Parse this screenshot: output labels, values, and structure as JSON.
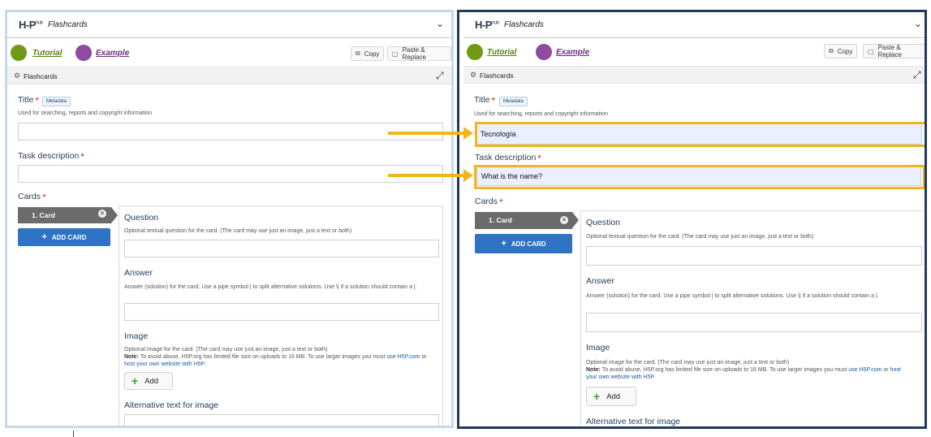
{
  "header": {
    "logo": "H-P",
    "logo_hub": "hub",
    "content_type": "Flashcards",
    "chevron": "⌄"
  },
  "chips": [
    {
      "label": "Tutorial",
      "color": "#6f9a15"
    },
    {
      "label": "Example",
      "color": "#8e4ba0"
    }
  ],
  "toolbar": {
    "copy_label": "Copy",
    "paste_label": "Paste & Replace"
  },
  "section": {
    "title": "Flashcards",
    "expand": "⤢"
  },
  "form": {
    "title_label": "Title",
    "required_mark": "*",
    "metadata_label": "Metadata",
    "title_desc": "Used for searching, reports and copyright information",
    "task_label": "Task description",
    "cards_label": "Cards",
    "card_tab_label": "1. Card",
    "card_remove": "×",
    "add_card_label": "ADD CARD",
    "add_plus": "+",
    "question_label": "Question",
    "question_desc": "Optional textual question for the card. (The card may use just an image, just a text or both)",
    "answer_label": "Answer",
    "answer_desc": "Answer (solution) for the card. Use a pipe symbol | to split alternative solutions. Use \\| if a solution should contain a |.",
    "image_label": "Image",
    "image_desc": "Optional image for the card. (The card may use just an image, just a text or both)",
    "note_bold": "Note:",
    "note_text": " To avoid abuse, H5P.org has limited file size on uploads to 16 MB. To use larger images you must ",
    "note_link1": "use H5P.com",
    "note_mid": " or ",
    "note_link2": "host your own website with H5P",
    "note_end": ".",
    "add_label": "Add",
    "alt_label": "Alternative text for image"
  },
  "left_values": {
    "title_value": "",
    "task_value": ""
  },
  "right_values": {
    "title_value": "Tecnología",
    "task_value": "What is the name?"
  },
  "colors": {
    "highlight": "#f2b61b",
    "add_card_bg": "#2f73c4",
    "left_frame": "#c5d9ee",
    "right_frame": "#1e3b5a"
  }
}
